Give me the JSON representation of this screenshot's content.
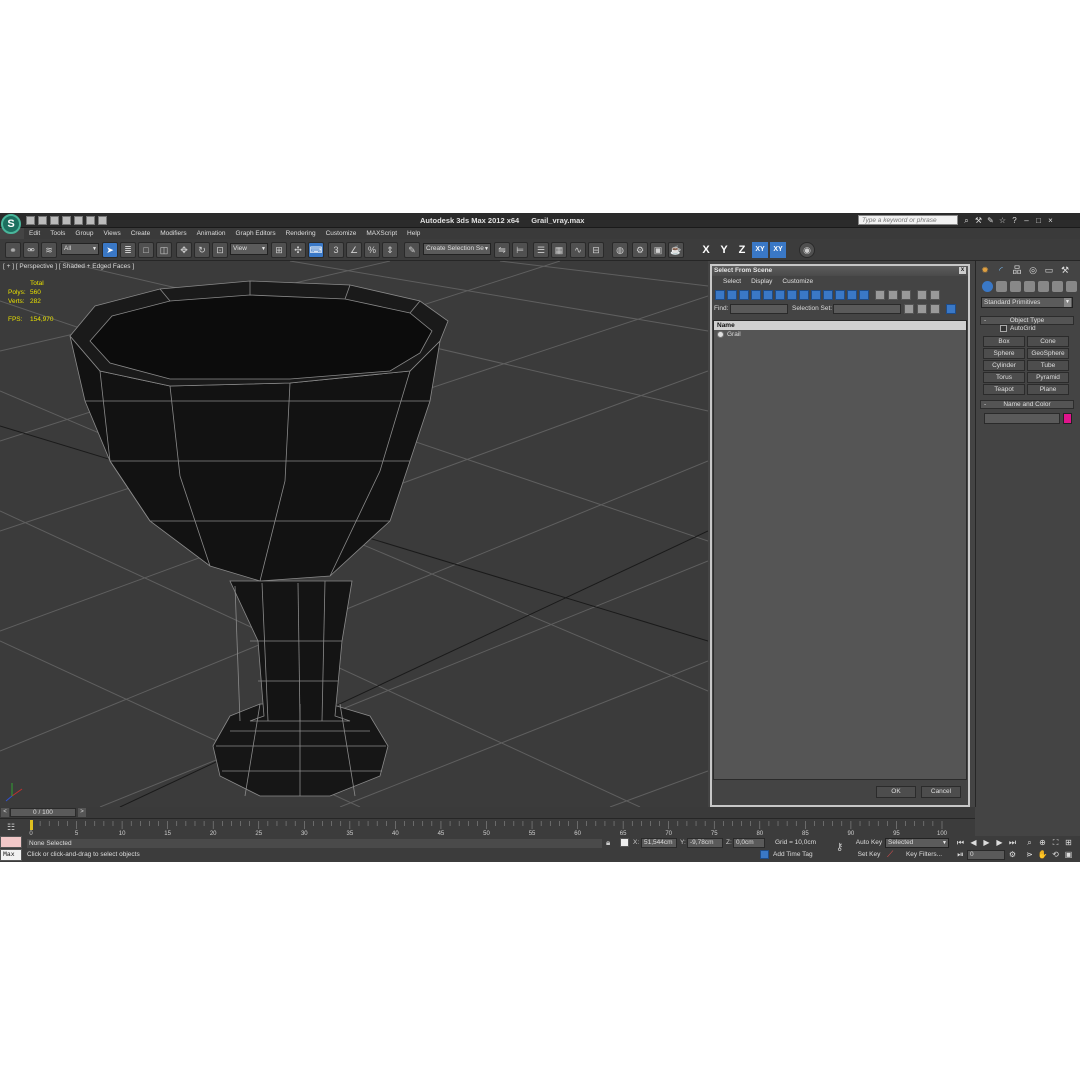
{
  "app": {
    "logo": "S",
    "title": "Autodesk 3ds Max  2012 x64",
    "file": "Grail_vray.max",
    "search_placeholder": "Type a keyword or phrase"
  },
  "menu": [
    "Edit",
    "Tools",
    "Group",
    "Views",
    "Create",
    "Modifiers",
    "Animation",
    "Graph Editors",
    "Rendering",
    "Customize",
    "MAXScript",
    "Help"
  ],
  "toolbar": {
    "filter": "All",
    "ref_coord": "View",
    "selection_set_placeholder": "Create Selection Se",
    "axes": [
      "X",
      "Y",
      "Z",
      "XY",
      "XY"
    ]
  },
  "viewport": {
    "label": "[ + ] [ Perspective ] [ Shaded + Edged Faces ]",
    "stats": {
      "total_label": "Total",
      "polys_label": "Polys:",
      "polys": "560",
      "verts_label": "Verts:",
      "verts": "282",
      "fps_label": "FPS:",
      "fps": "154,970"
    }
  },
  "dialog": {
    "title": "Select From Scene",
    "close": "x",
    "menu": [
      "Select",
      "Display",
      "Customize"
    ],
    "find_label": "Find:",
    "selection_set_label": "Selection Set:",
    "column_name": "Name",
    "items": [
      "Grail"
    ],
    "ok": "OK",
    "cancel": "Cancel"
  },
  "command_panel": {
    "category": "Standard Primitives",
    "object_type_title": "Object Type",
    "autogrid": "AutoGrid",
    "primitives": [
      "Box",
      "Cone",
      "Sphere",
      "GeoSphere",
      "Cylinder",
      "Tube",
      "Torus",
      "Pyramid",
      "Teapot",
      "Plane"
    ],
    "name_color_title": "Name and Color",
    "object_color": "#e0148c"
  },
  "timeline": {
    "slider": "0 / 100",
    "ticks": [
      "0",
      "5",
      "10",
      "15",
      "20",
      "25",
      "30",
      "35",
      "40",
      "45",
      "50",
      "55",
      "60",
      "65",
      "70",
      "75",
      "80",
      "85",
      "90",
      "95",
      "100"
    ]
  },
  "status": {
    "maxscript": "Max",
    "selection": "None Selected",
    "prompt": "Click or click-and-drag to select objects",
    "x_label": "X:",
    "x": "51,544cm",
    "y_label": "Y:",
    "y": "-9,78cm",
    "z_label": "Z:",
    "z": "0,0cm",
    "grid": "Grid = 10,0cm",
    "add_time_tag": "Add Time Tag",
    "auto_key": "Auto Key",
    "set_key": "Set Key",
    "key_mode": "Selected",
    "key_filters": "Key Filters...",
    "frame": "0"
  }
}
